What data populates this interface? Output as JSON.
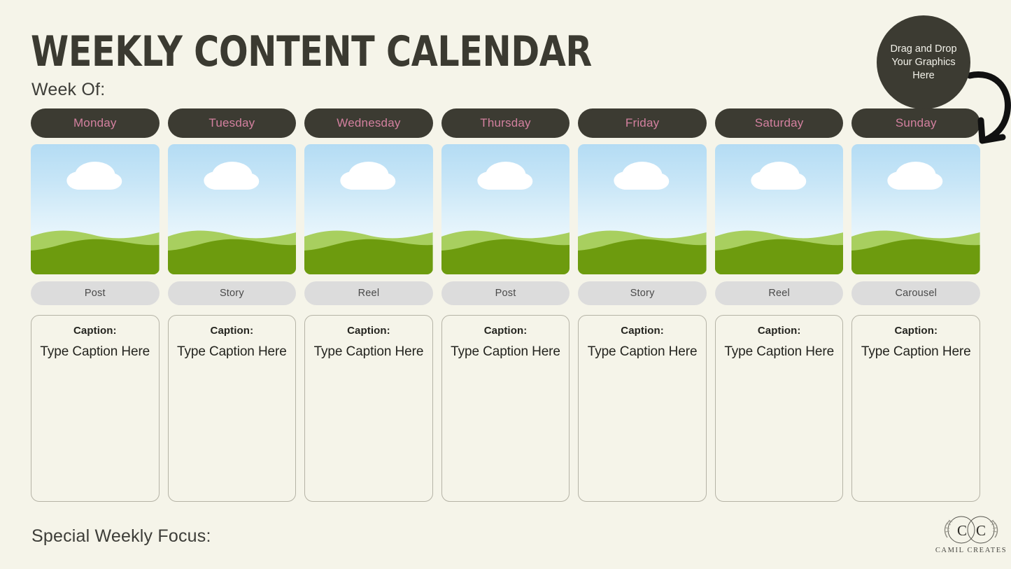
{
  "header": {
    "title": "WEEKLY CONTENT CALENDAR",
    "week_of_label": "Week Of:"
  },
  "drop_zone": {
    "text": "Drag and Drop Your Graphics Here",
    "arrow_icon": "curved-arrow-icon"
  },
  "footer": {
    "focus_label": "Special Weekly Focus:",
    "brand_name": "CAMIL CREATES",
    "brand_mark_icon": "cc-monogram-icon"
  },
  "caption_defaults": {
    "title": "Caption:",
    "placeholder": "Type Caption Here"
  },
  "colors": {
    "background": "#f5f4e9",
    "dark": "#3c3b32",
    "day_text": "#d3809f",
    "pill_gray": "#dcdcdc",
    "border": "#b5b3a6",
    "sky_top": "#b4dcf4",
    "hill_light": "#a8cf5f",
    "hill_dark": "#6d9b0e"
  },
  "columns": [
    {
      "day": "Monday",
      "post_type": "Post",
      "image_placeholder": "landscape-placeholder-icon",
      "caption_title": "Caption:",
      "caption_value": "Type Caption Here"
    },
    {
      "day": "Tuesday",
      "post_type": "Story",
      "image_placeholder": "landscape-placeholder-icon",
      "caption_title": "Caption:",
      "caption_value": "Type Caption Here"
    },
    {
      "day": "Wednesday",
      "post_type": "Reel",
      "image_placeholder": "landscape-placeholder-icon",
      "caption_title": "Caption:",
      "caption_value": "Type Caption Here"
    },
    {
      "day": "Thursday",
      "post_type": "Post",
      "image_placeholder": "landscape-placeholder-icon",
      "caption_title": "Caption:",
      "caption_value": "Type Caption Here"
    },
    {
      "day": "Friday",
      "post_type": "Story",
      "image_placeholder": "landscape-placeholder-icon",
      "caption_title": "Caption:",
      "caption_value": "Type Caption Here"
    },
    {
      "day": "Saturday",
      "post_type": "Reel",
      "image_placeholder": "landscape-placeholder-icon",
      "caption_title": "Caption:",
      "caption_value": "Type Caption Here"
    },
    {
      "day": "Sunday",
      "post_type": "Carousel",
      "image_placeholder": "landscape-placeholder-icon",
      "caption_title": "Caption:",
      "caption_value": "Type Caption Here"
    }
  ]
}
